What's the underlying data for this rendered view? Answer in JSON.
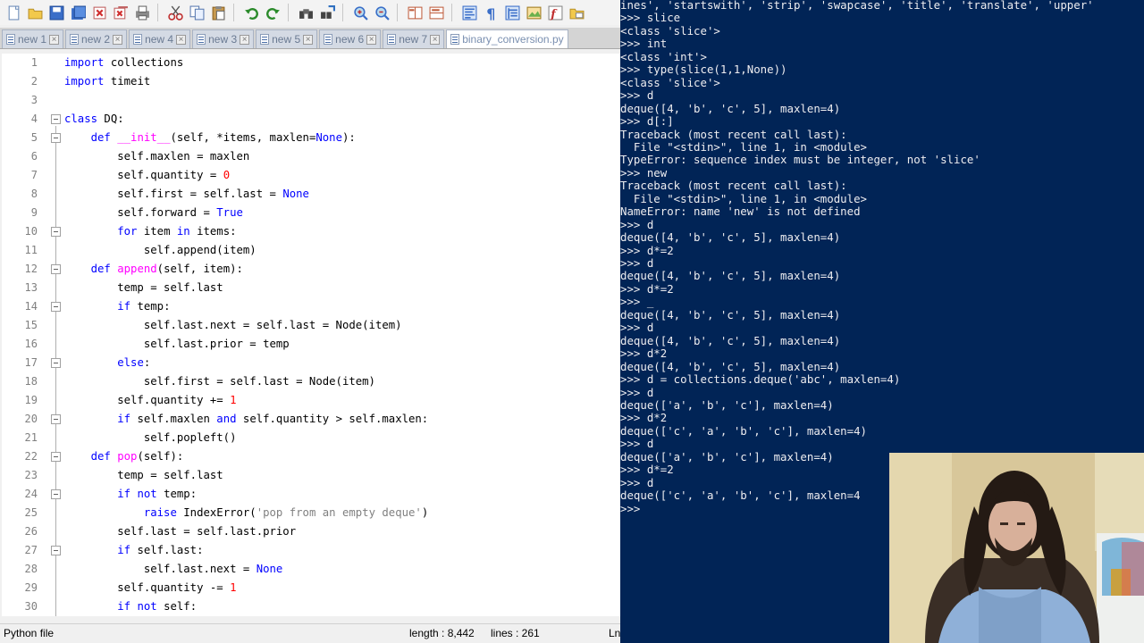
{
  "toolbar": {
    "icons": [
      "new-file-icon",
      "open-icon",
      "save-icon",
      "save-all-icon",
      "close-icon",
      "close-all-icon",
      "print-icon",
      "cut-icon",
      "copy-icon",
      "paste-icon",
      "undo-icon",
      "redo-icon",
      "find-icon",
      "replace-icon",
      "zoom-in-icon",
      "zoom-out-icon",
      "sync-v-icon",
      "sync-h-icon",
      "word-wrap-icon",
      "show-all-chars-icon",
      "indent-guide-icon",
      "doc-map-icon",
      "function-list-icon",
      "folder-workspace-icon"
    ]
  },
  "tabs": [
    {
      "label": "new 1"
    },
    {
      "label": "new 2"
    },
    {
      "label": "new 4"
    },
    {
      "label": "new 3"
    },
    {
      "label": "new 5"
    },
    {
      "label": "new 6"
    },
    {
      "label": "new 7"
    },
    {
      "label": "binary_conversion.py"
    }
  ],
  "code": {
    "lines": [
      {
        "n": "1",
        "text": "import collections"
      },
      {
        "n": "2",
        "text": "import timeit"
      },
      {
        "n": "3",
        "text": ""
      },
      {
        "n": "4",
        "text": "class DQ:"
      },
      {
        "n": "5",
        "text": "    def __init__(self, *items, maxlen=None):"
      },
      {
        "n": "6",
        "text": "        self.maxlen = maxlen"
      },
      {
        "n": "7",
        "text": "        self.quantity = 0"
      },
      {
        "n": "8",
        "text": "        self.first = self.last = None"
      },
      {
        "n": "9",
        "text": "        self.forward = True"
      },
      {
        "n": "10",
        "text": "        for item in items:"
      },
      {
        "n": "11",
        "text": "            self.append(item)"
      },
      {
        "n": "12",
        "text": "    def append(self, item):"
      },
      {
        "n": "13",
        "text": "        temp = self.last"
      },
      {
        "n": "14",
        "text": "        if temp:"
      },
      {
        "n": "15",
        "text": "            self.last.next = self.last = Node(item)"
      },
      {
        "n": "16",
        "text": "            self.last.prior = temp"
      },
      {
        "n": "17",
        "text": "        else:"
      },
      {
        "n": "18",
        "text": "            self.first = self.last = Node(item)"
      },
      {
        "n": "19",
        "text": "        self.quantity += 1"
      },
      {
        "n": "20",
        "text": "        if self.maxlen and self.quantity > self.maxlen:"
      },
      {
        "n": "21",
        "text": "            self.popleft()"
      },
      {
        "n": "22",
        "text": "    def pop(self):"
      },
      {
        "n": "23",
        "text": "        temp = self.last"
      },
      {
        "n": "24",
        "text": "        if not temp:"
      },
      {
        "n": "25",
        "text": "            raise IndexError('pop from an empty deque')"
      },
      {
        "n": "26",
        "text": "        self.last = self.last.prior"
      },
      {
        "n": "27",
        "text": "        if self.last:"
      },
      {
        "n": "28",
        "text": "            self.last.next = None"
      },
      {
        "n": "29",
        "text": "        self.quantity -= 1"
      },
      {
        "n": "30",
        "text": "        if not self:"
      }
    ]
  },
  "status": {
    "file_type": "Python file",
    "length": "length : 8,442",
    "lines": "lines : 261",
    "ln": "Ln"
  },
  "console": {
    "lines": [
      "ines', 'startswith', 'strip', 'swapcase', 'title', 'translate', 'upper'",
      ">>> slice",
      "<class 'slice'>",
      ">>> int",
      "<class 'int'>",
      ">>> type(slice(1,1,None))",
      "<class 'slice'>",
      ">>> d",
      "deque([4, 'b', 'c', 5], maxlen=4)",
      ">>> d[:]",
      "Traceback (most recent call last):",
      "  File \"<stdin>\", line 1, in <module>",
      "TypeError: sequence index must be integer, not 'slice'",
      ">>> new",
      "Traceback (most recent call last):",
      "  File \"<stdin>\", line 1, in <module>",
      "NameError: name 'new' is not defined",
      ">>> d",
      "deque([4, 'b', 'c', 5], maxlen=4)",
      ">>> d*=2",
      ">>> d",
      "deque([4, 'b', 'c', 5], maxlen=4)",
      ">>> d*=2",
      ">>> _",
      "deque([4, 'b', 'c', 5], maxlen=4)",
      ">>> d",
      "deque([4, 'b', 'c', 5], maxlen=4)",
      ">>> d*2",
      "deque([4, 'b', 'c', 5], maxlen=4)",
      ">>> d = collections.deque('abc', maxlen=4)",
      ">>> d",
      "deque(['a', 'b', 'c'], maxlen=4)",
      ">>> d*2",
      "deque(['c', 'a', 'b', 'c'], maxlen=4)",
      ">>> d",
      "deque(['a', 'b', 'c'], maxlen=4)",
      ">>> d*=2",
      ">>> d",
      "deque(['c', 'a', 'b', 'c'], maxlen=4",
      ">>>"
    ]
  },
  "colors": {
    "console_bg": "#012456",
    "console_fg": "#eeedf0",
    "keyword": "#0000ff",
    "function_name": "#ff00ff",
    "number": "#ff0000",
    "string": "#808080",
    "line_number": "#808080"
  }
}
